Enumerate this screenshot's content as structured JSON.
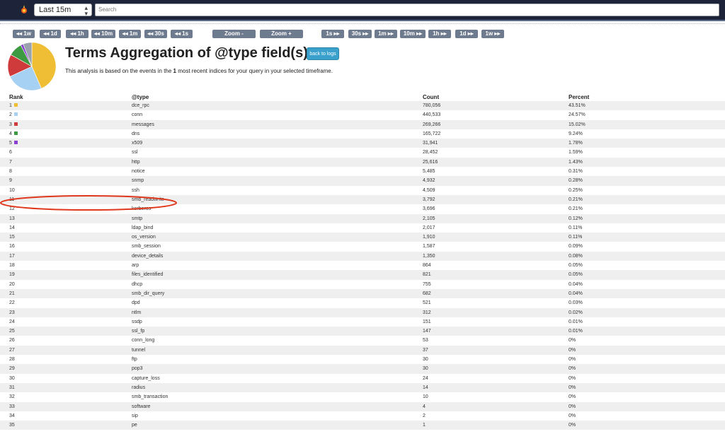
{
  "topbar": {
    "timeframe": "Last 15m",
    "search_placeholder": "Search"
  },
  "nav": {
    "back": [
      "◂◂ 1w",
      "◂◂ 1d",
      "◂◂ 1h",
      "◂◂ 10m",
      "◂◂ 1m",
      "◂◂ 30s",
      "◂◂ 1s"
    ],
    "zoom_out": "Zoom -",
    "zoom_in": "Zoom +",
    "forward": [
      "1s ▸▸",
      "30s ▸▸",
      "1m ▸▸",
      "10m ▸▸",
      "1h ▸▸",
      "1d ▸▸",
      "1w ▸▸"
    ]
  },
  "header": {
    "title": "Terms Aggregation of @type field(s)",
    "back_button": "back to logs",
    "subtitle_pre": "This analysis is based on the events in the ",
    "subtitle_num": "1",
    "subtitle_post": " most recent indices for your query in your selected timeframe."
  },
  "table": {
    "columns": [
      "Rank",
      "@type",
      "Count",
      "Percent"
    ],
    "rows": [
      {
        "rank": "1",
        "type": "dce_rpc",
        "count": "780,056",
        "percent": "43.51%",
        "color": "#efbe34"
      },
      {
        "rank": "2",
        "type": "conn",
        "count": "440,533",
        "percent": "24.57%",
        "color": "#a7d1f3"
      },
      {
        "rank": "3",
        "type": "messages",
        "count": "269,266",
        "percent": "15.02%",
        "color": "#cf3a3a"
      },
      {
        "rank": "4",
        "type": "dns",
        "count": "165,722",
        "percent": "9.24%",
        "color": "#3e9a40"
      },
      {
        "rank": "5",
        "type": "x509",
        "count": "31,941",
        "percent": "1.78%",
        "color": "#8a3fd1"
      },
      {
        "rank": "6",
        "type": "ssl",
        "count": "28,452",
        "percent": "1.59%"
      },
      {
        "rank": "7",
        "type": "http",
        "count": "25,616",
        "percent": "1.43%"
      },
      {
        "rank": "8",
        "type": "notice",
        "count": "5,485",
        "percent": "0.31%"
      },
      {
        "rank": "9",
        "type": "snmp",
        "count": "4,932",
        "percent": "0.28%"
      },
      {
        "rank": "10",
        "type": "ssh",
        "count": "4,509",
        "percent": "0.25%"
      },
      {
        "rank": "11",
        "type": "smb_readwrite",
        "count": "3,792",
        "percent": "0.21%"
      },
      {
        "rank": "12",
        "type": "kerberos",
        "count": "3,696",
        "percent": "0.21%"
      },
      {
        "rank": "13",
        "type": "smtp",
        "count": "2,105",
        "percent": "0.12%"
      },
      {
        "rank": "14",
        "type": "ldap_bind",
        "count": "2,017",
        "percent": "0.11%"
      },
      {
        "rank": "15",
        "type": "os_version",
        "count": "1,910",
        "percent": "0.11%"
      },
      {
        "rank": "16",
        "type": "smb_session",
        "count": "1,587",
        "percent": "0.09%"
      },
      {
        "rank": "17",
        "type": "device_details",
        "count": "1,350",
        "percent": "0.08%"
      },
      {
        "rank": "18",
        "type": "arp",
        "count": "864",
        "percent": "0.05%"
      },
      {
        "rank": "19",
        "type": "files_identified",
        "count": "821",
        "percent": "0.05%"
      },
      {
        "rank": "20",
        "type": "dhcp",
        "count": "755",
        "percent": "0.04%"
      },
      {
        "rank": "21",
        "type": "smb_dir_query",
        "count": "682",
        "percent": "0.04%"
      },
      {
        "rank": "22",
        "type": "dpd",
        "count": "521",
        "percent": "0.03%"
      },
      {
        "rank": "23",
        "type": "ntlm",
        "count": "312",
        "percent": "0.02%"
      },
      {
        "rank": "24",
        "type": "ssdp",
        "count": "151",
        "percent": "0.01%"
      },
      {
        "rank": "25",
        "type": "ssl_fp",
        "count": "147",
        "percent": "0.01%"
      },
      {
        "rank": "26",
        "type": "conn_long",
        "count": "53",
        "percent": "0%"
      },
      {
        "rank": "27",
        "type": "tunnel",
        "count": "37",
        "percent": "0%"
      },
      {
        "rank": "28",
        "type": "ftp",
        "count": "30",
        "percent": "0%"
      },
      {
        "rank": "29",
        "type": "pop3",
        "count": "30",
        "percent": "0%"
      },
      {
        "rank": "30",
        "type": "capture_loss",
        "count": "24",
        "percent": "0%"
      },
      {
        "rank": "31",
        "type": "radius",
        "count": "14",
        "percent": "0%"
      },
      {
        "rank": "32",
        "type": "smb_transaction",
        "count": "10",
        "percent": "0%"
      },
      {
        "rank": "33",
        "type": "software",
        "count": "4",
        "percent": "0%"
      },
      {
        "rank": "34",
        "type": "sip",
        "count": "2",
        "percent": "0%"
      },
      {
        "rank": "35",
        "type": "pe",
        "count": "1",
        "percent": "0%"
      }
    ]
  },
  "chart_data": {
    "type": "pie",
    "labels": [
      "dce_rpc",
      "conn",
      "messages",
      "dns",
      "x509",
      "other"
    ],
    "values": [
      43.51,
      24.57,
      15.02,
      9.24,
      1.78,
      5.88
    ],
    "colors": [
      "#efbe34",
      "#a7d1f3",
      "#cf3a3a",
      "#3e9a40",
      "#8a3fd1",
      "#9aa2ad"
    ]
  },
  "annotation": {
    "color": "#e0381c",
    "highlighted_rank": "11"
  }
}
